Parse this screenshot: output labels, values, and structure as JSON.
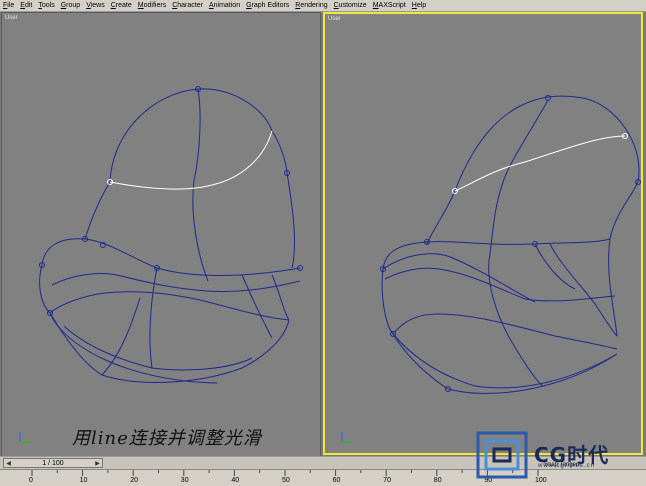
{
  "menu": [
    "File",
    "Edit",
    "Tools",
    "Group",
    "Views",
    "Create",
    "Modifiers",
    "Character",
    "Animation",
    "Graph Editors",
    "Rendering",
    "Customize",
    "MAXScript",
    "Help"
  ],
  "viewports": {
    "left": {
      "label": "User"
    },
    "right": {
      "label": "User"
    }
  },
  "caption": "用line连接并调整光滑",
  "timeline": {
    "frame": "1 / 100"
  },
  "ruler_ticks": [
    "0",
    "10",
    "20",
    "30",
    "40",
    "50",
    "60",
    "70",
    "80",
    "90",
    "100"
  ],
  "status": "Snap Tangent",
  "logo": {
    "text": "CG时代",
    "sub": "www.cgtimes.cn"
  },
  "colors": {
    "spline": "#1e2a8c",
    "selected": "#ffffff",
    "active_border": "#f2e63b"
  }
}
